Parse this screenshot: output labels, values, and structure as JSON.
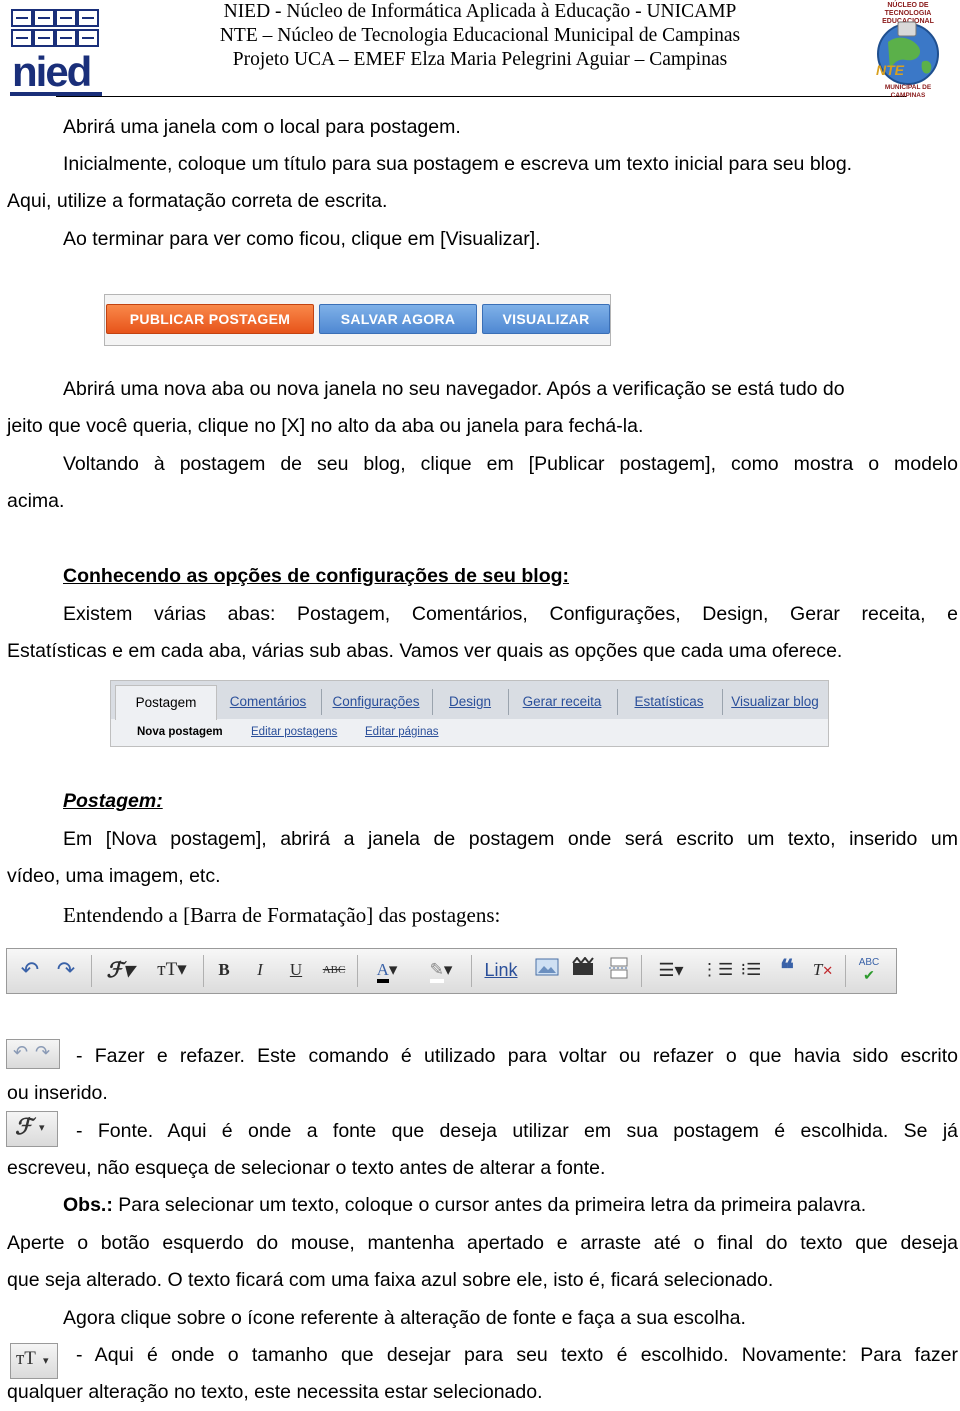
{
  "header": {
    "logo_left": "nied",
    "line1": "NIED - Núcleo de Informática Aplicada à Educação - UNICAMP",
    "line2": "NTE – Núcleo de Tecnologia Educacional Municipal de Campinas",
    "line3": "Projeto UCA – EMEF Elza Maria Pelegrini Aguiar – Campinas",
    "logo_right_top": "NÚCLEO DE TECNOLOGIA EDUCACIONAL",
    "logo_right_mid": "NTE",
    "logo_right_bottom": "MUNICIPAL DE CAMPINAS"
  },
  "body": {
    "p1": "Abrirá uma janela com o local para postagem.",
    "p2a": "Inicialmente, coloque um título para sua postagem e escreva um texto inicial para seu blog.",
    "p2b": "Aqui, utilize a formatação correta de escrita.",
    "p3": "Ao terminar para ver como ficou, clique em [Visualizar].",
    "buttons": {
      "publish": "PUBLICAR POSTAGEM",
      "save": "SALVAR AGORA",
      "preview": "VISUALIZAR"
    },
    "p4a": "Abrirá uma nova aba ou nova janela no seu navegador. Após a verificação se está tudo do",
    "p4b": "jeito que você queria, clique no [X] no alto da aba ou janela para fechá-la.",
    "p5a": "Voltando à postagem de seu blog, clique em [Publicar postagem], como mostra o modelo",
    "p5b": "acima.",
    "h1": "Conhecendo as opções de configurações de seu blog:",
    "p6a": "Existem várias abas: Postagem, Comentários, Configurações, Design, Gerar receita, e",
    "p6b": "Estatísticas e em cada aba, várias sub abas. Vamos ver quais as  opções que cada uma oferece.",
    "tabs": [
      "Postagem",
      "Comentários",
      "Configurações",
      "Design",
      "Gerar receita",
      "Estatísticas",
      "Visualizar blog"
    ],
    "subtabs": [
      "Nova postagem",
      "Editar postagens",
      "Editar páginas"
    ],
    "h2": "Postagem:",
    "p7a": "Em [Nova postagem], abrirá a janela de postagem onde será escrito um texto, inserido um",
    "p7b": "vídeo, uma imagem, etc.",
    "p8": "Entendendo a [Barra de Formatação] das postagens:",
    "toolbar_link": "Link",
    "p9a": "- Fazer e refazer. Este comando é utilizado para voltar ou refazer o que havia sido escrito",
    "p9b": "ou inserido.",
    "p10a": "- Fonte. Aqui é onde a fonte que deseja utilizar em sua postagem é escolhida. Se já",
    "p10b": "escreveu, não esqueça de selecionar o texto antes de alterar a fonte.",
    "obs_label": "Obs.:",
    "p11a": " Para selecionar um texto, coloque o cursor antes da primeira letra da primeira palavra.",
    "p11b": "Aperte o botão esquerdo do mouse, mantenha apertado e arraste até o final do texto que deseja",
    "p11c": "que seja alterado. O texto ficará com uma faixa azul sobre ele, isto é, ficará selecionado.",
    "p12": "Agora clique sobre o ícone referente à alteração de fonte e faça a sua escolha.",
    "p13a": "- Aqui é onde o tamanho que desejar para seu texto é escolhido. Novamente: Para fazer",
    "p13b": "qualquer alteração no texto, este necessita estar selecionado."
  },
  "icons": [
    "undo-icon",
    "redo-icon",
    "font-icon",
    "text-size-icon",
    "bold-icon",
    "italic-icon",
    "underline-icon",
    "strikethrough-icon",
    "text-color-icon",
    "highlight-icon",
    "link",
    "image-icon",
    "video-icon",
    "page-break-icon",
    "align-icon",
    "numbered-list-icon",
    "bullet-list-icon",
    "quote-icon",
    "clear-format-icon",
    "spellcheck-icon"
  ],
  "colors": {
    "orange_button": "#e7531a",
    "blue_button": "#4f88d2",
    "link_blue": "#2a4f9a",
    "nied_blue": "#1a2f7a"
  }
}
